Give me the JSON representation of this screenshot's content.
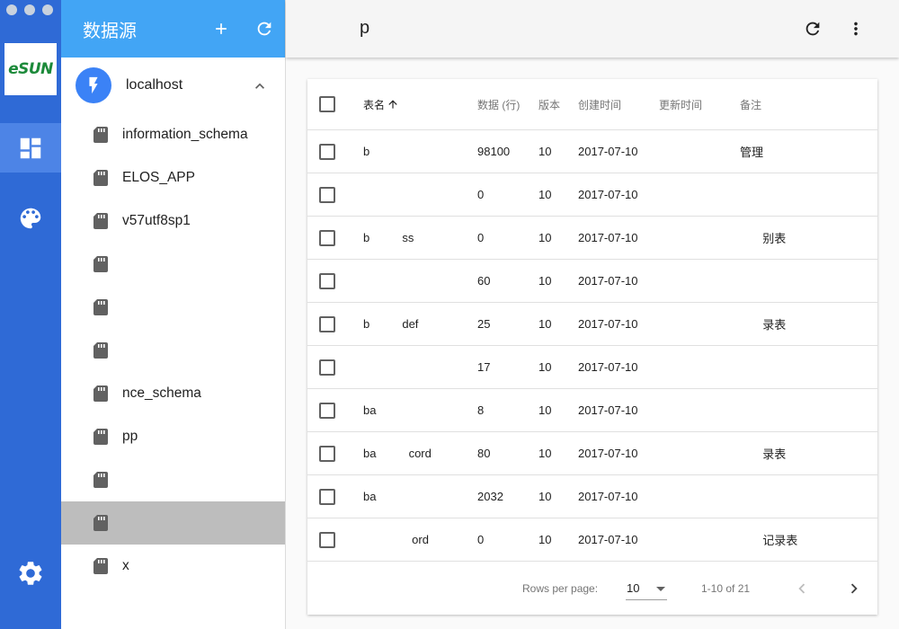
{
  "window": {
    "traffic_lights": [
      "close",
      "minimize",
      "zoom"
    ]
  },
  "rail": {
    "logo_text": "eSUN",
    "items": [
      {
        "icon": "dashboard-icon",
        "active": true
      },
      {
        "icon": "palette-icon",
        "active": false
      }
    ],
    "bottom_icon": "settings-icon",
    "colors": {
      "background": "#2f6ad6",
      "active": "#4d84e6"
    }
  },
  "sources": {
    "title": "数据源",
    "add_icon": "plus-icon",
    "refresh_icon": "refresh-icon",
    "connection": {
      "name": "localhost",
      "icon": "lightning-bolt-icon",
      "expanded": true
    },
    "databases": [
      {
        "name": "information_schema"
      },
      {
        "name": "ELOS_APP"
      },
      {
        "name": "v57utf8sp1"
      },
      {
        "name": ""
      },
      {
        "name": ""
      },
      {
        "name": ""
      },
      {
        "name": "nce_schema"
      },
      {
        "name": "pp"
      },
      {
        "name": ""
      },
      {
        "name": "",
        "selected": true
      },
      {
        "name": "x"
      }
    ],
    "colors": {
      "header": "#42a5f5",
      "selected": "#bdbdbd"
    }
  },
  "main": {
    "title": "p",
    "refresh_icon": "refresh-icon",
    "more_icon": "more-vertical-icon"
  },
  "table": {
    "columns": {
      "name": "表名",
      "rows": "数据 (行)",
      "version": "版本",
      "created": "创建时间",
      "updated": "更新时间",
      "note": "备注"
    },
    "sort_icon": "arrow-up-icon",
    "rows": [
      {
        "name": "b",
        "rows": "98100",
        "version": "10",
        "created": "2017-07-10",
        "updated": "",
        "note": "管理"
      },
      {
        "name": "",
        "rows": "0",
        "version": "10",
        "created": "2017-07-10",
        "updated": "",
        "note": ""
      },
      {
        "name": "b          ss",
        "rows": "0",
        "version": "10",
        "created": "2017-07-10",
        "updated": "",
        "note": "       别表"
      },
      {
        "name": "",
        "rows": "60",
        "version": "10",
        "created": "2017-07-10",
        "updated": "",
        "note": ""
      },
      {
        "name": "b          def",
        "rows": "25",
        "version": "10",
        "created": "2017-07-10",
        "updated": "",
        "note": "       录表"
      },
      {
        "name": "",
        "rows": "17",
        "version": "10",
        "created": "2017-07-10",
        "updated": "",
        "note": ""
      },
      {
        "name": "ba",
        "rows": "8",
        "version": "10",
        "created": "2017-07-10",
        "updated": "",
        "note": ""
      },
      {
        "name": "ba          cord",
        "rows": "80",
        "version": "10",
        "created": "2017-07-10",
        "updated": "",
        "note": "       录表"
      },
      {
        "name": "ba",
        "rows": "2032",
        "version": "10",
        "created": "2017-07-10",
        "updated": "",
        "note": ""
      },
      {
        "name": "               ord",
        "rows": "0",
        "version": "10",
        "created": "2017-07-10",
        "updated": "",
        "note": "       记录表"
      }
    ],
    "footer": {
      "rows_per_page_label": "Rows per page:",
      "rows_per_page_value": "10",
      "range": "1-10 of 21",
      "prev_icon": "chevron-left-icon",
      "next_icon": "chevron-right-icon"
    }
  }
}
